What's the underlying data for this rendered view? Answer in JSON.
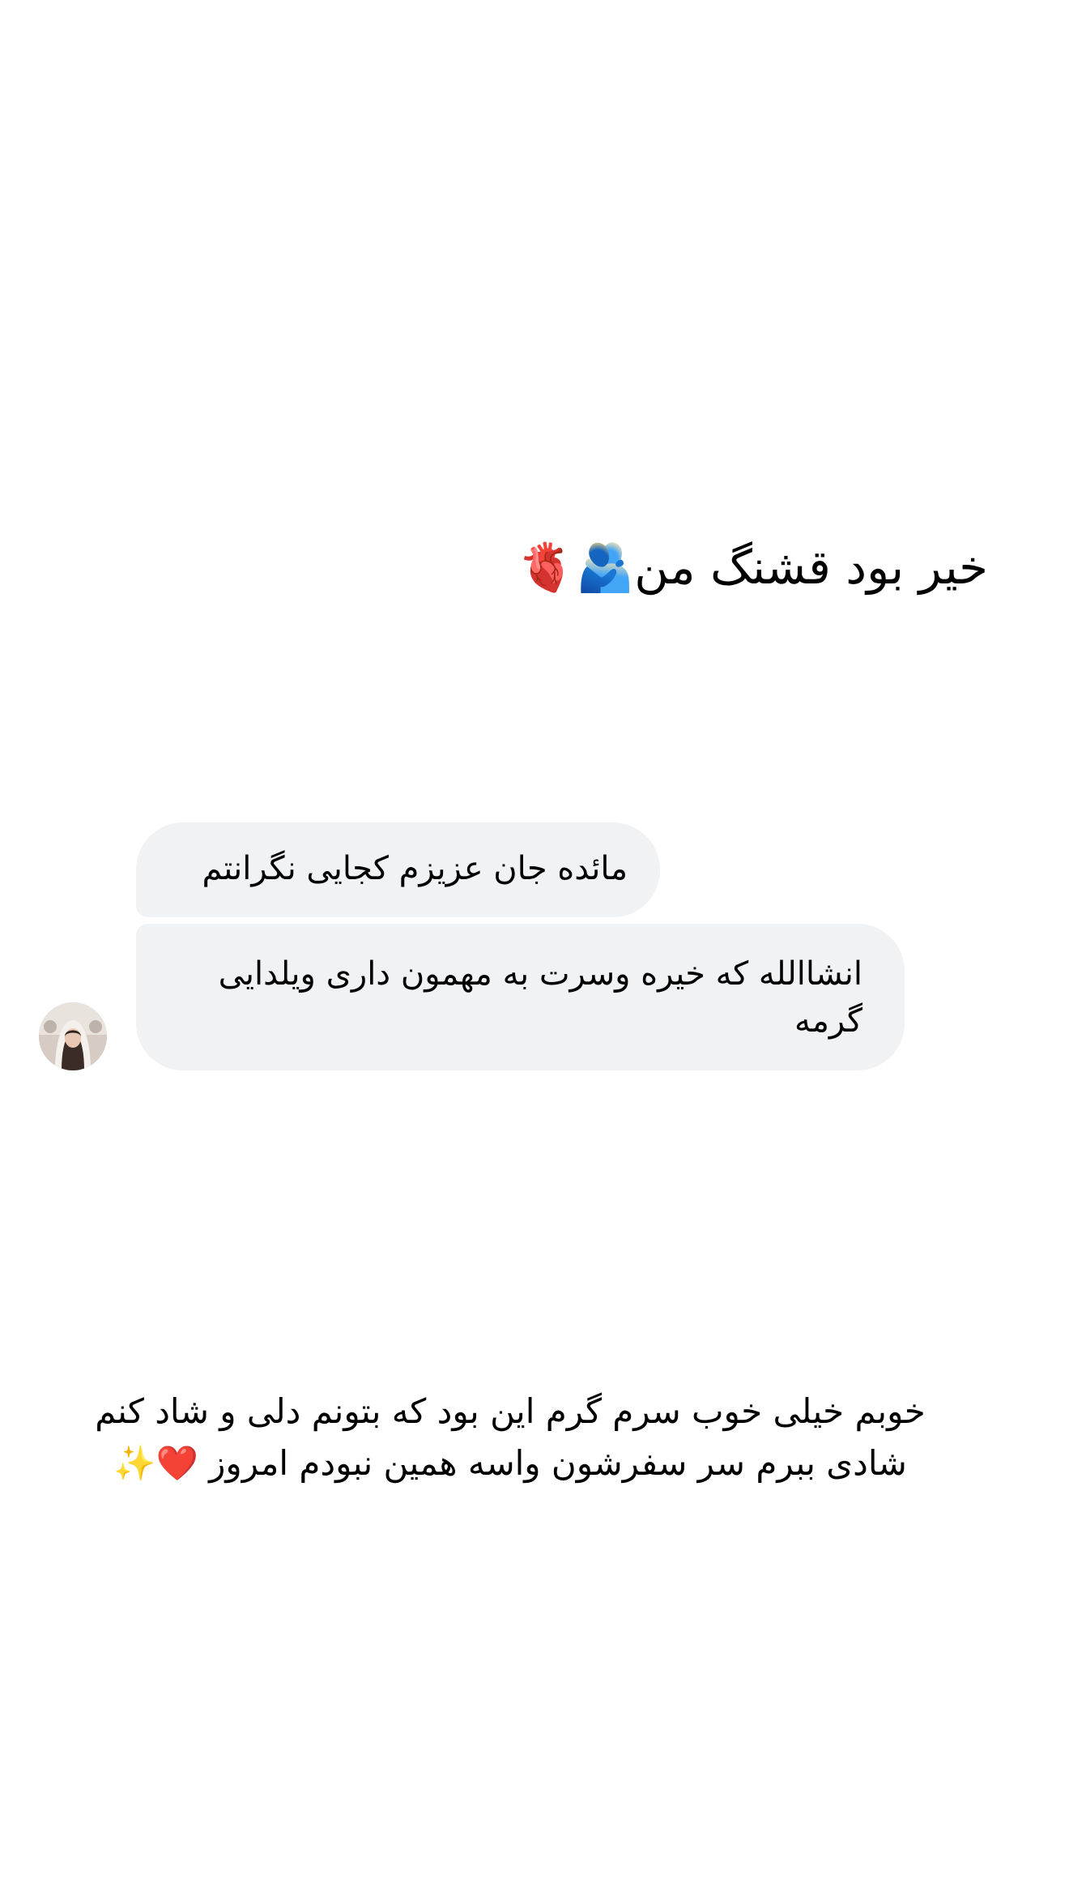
{
  "top_caption": {
    "text": "خیر بود قشنگ من",
    "emojis": "🫂🫀"
  },
  "messages": [
    {
      "text": "مائده جان عزیزم کجایی نگرانتم"
    },
    {
      "text": "انشاالله که خیره وسرت به مهمون داری ویلدایی گرمه"
    }
  ],
  "avatar": {
    "icon": "profile-photo"
  },
  "bottom_caption": {
    "text": "خوبم خیلی خوب سرم گرم این بود که بتونم دلی و شاد کنم شادی ببرم سر سفرشون واسه همین نبودم امروز",
    "emojis": "❤️✨"
  }
}
